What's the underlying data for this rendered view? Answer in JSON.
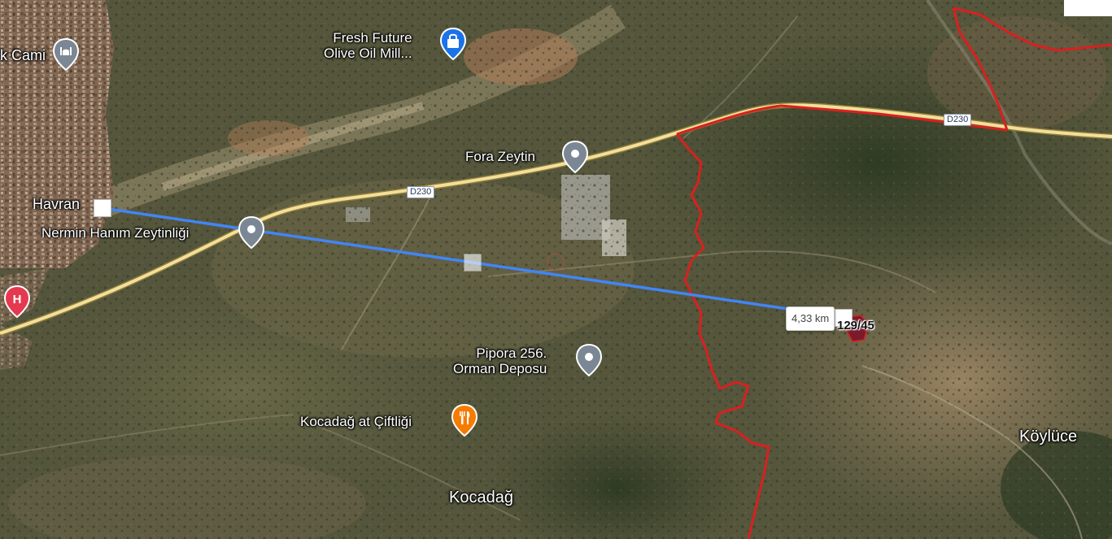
{
  "places": {
    "havran": "Havran",
    "kamii_partial": "k Cami",
    "koyluce": "Köylüce",
    "kocadag": "Kocadağ"
  },
  "pois": {
    "fresh_future": {
      "line1": "Fresh Future",
      "line2": "Olive Oil Mill...",
      "icon": "shopping-bag-icon",
      "color": "#1a73e8"
    },
    "fora_zeytin": {
      "label": "Fora Zeytin",
      "icon": "location-pin-icon",
      "color": "#7b8794"
    },
    "nermin_hanim": {
      "label": "Nermin Hanım Zeytinliği",
      "icon": "location-pin-icon",
      "color": "#7b8794"
    },
    "pipora": {
      "line1": "Pipora 256.",
      "line2": "Orman Deposu",
      "icon": "location-pin-icon",
      "color": "#7b8794"
    },
    "kocadag_at": {
      "label": "Kocadağ at Çiftliği",
      "icon": "restaurant-icon",
      "color": "#f57c00"
    },
    "hospital": {
      "icon": "hospital-icon",
      "color": "#e53950",
      "letter": "H"
    },
    "mosque": {
      "icon": "mosque-icon",
      "color": "#7b8794"
    }
  },
  "roads": {
    "shield_1": "D230",
    "shield_2": "D230"
  },
  "measure": {
    "distance": "4,33 km",
    "line_color": "#4285f4"
  },
  "parcel": {
    "label": "129/45",
    "boundary_color": "#d9201f"
  }
}
